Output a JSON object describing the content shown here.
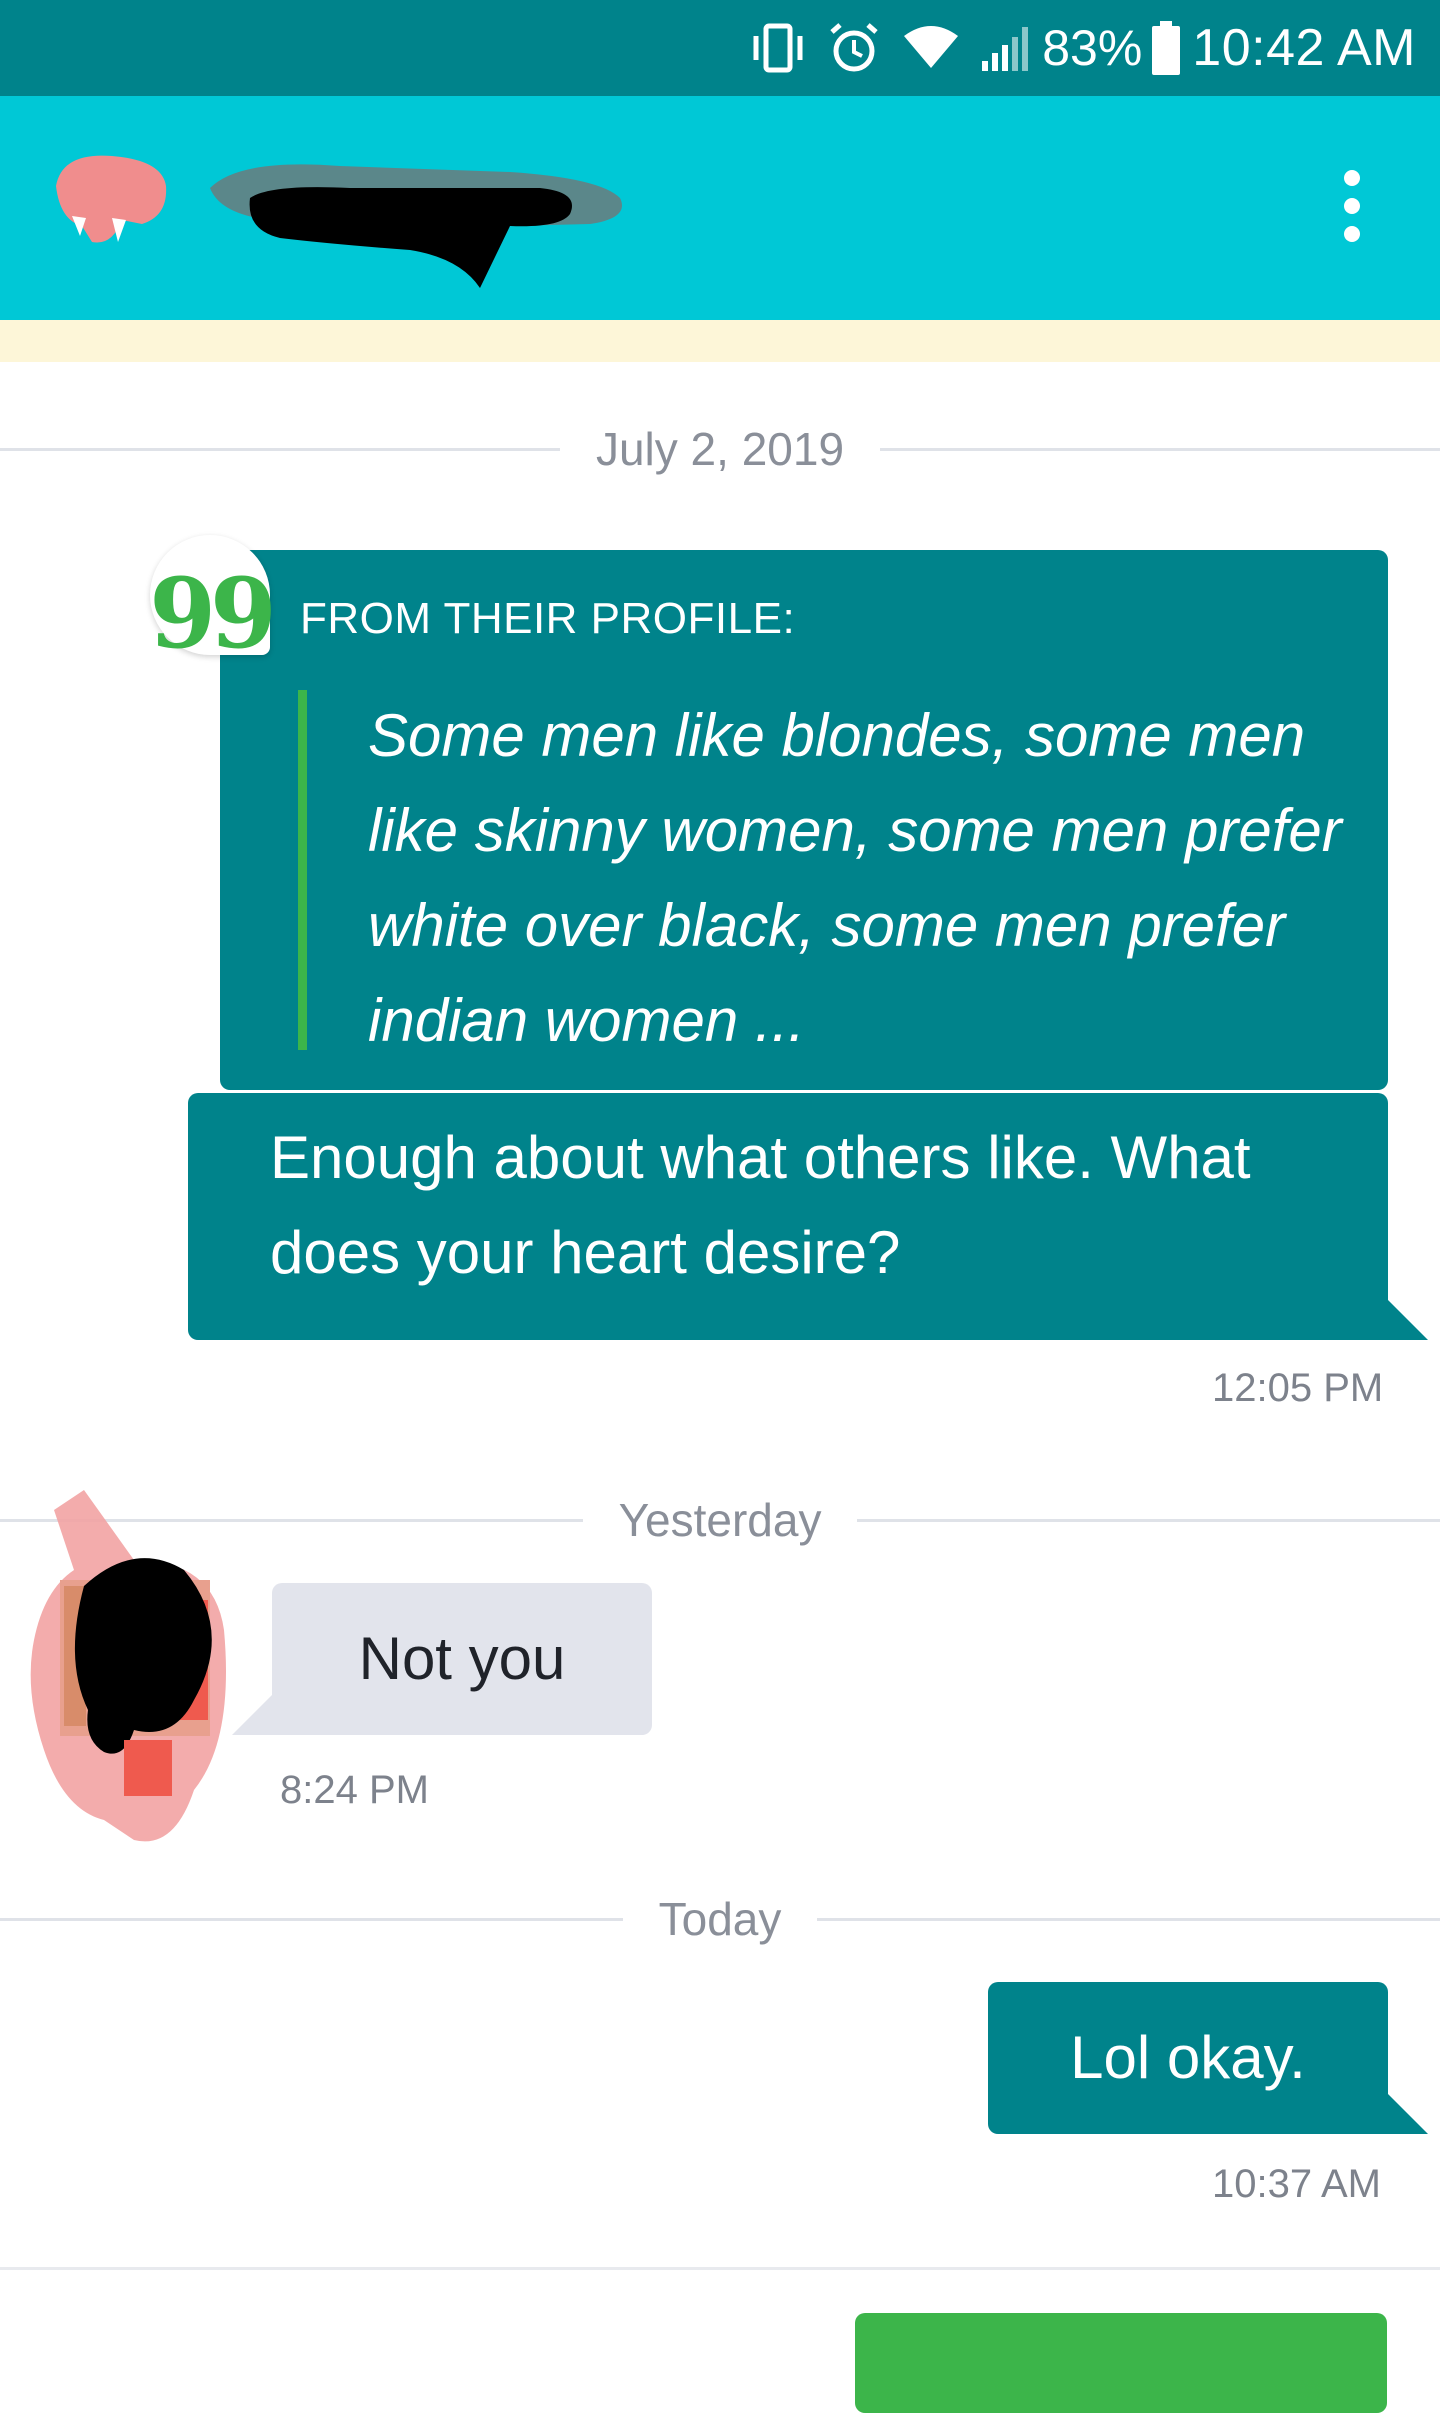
{
  "status_bar": {
    "battery_percent": "83%",
    "time": "10:42 AM",
    "icons": [
      "vibrate-icon",
      "alarm-icon",
      "wifi-icon",
      "signal-icon",
      "battery-icon"
    ]
  },
  "app_bar": {
    "contact_name_redacted": true,
    "overflow_icon": "more-vert-icon"
  },
  "conversation": {
    "separators": {
      "first": "July 2, 2019",
      "second": "Yesterday",
      "third": "Today"
    },
    "profile_quote": {
      "label": "FROM THEIR PROFILE:",
      "badge_glyph": "99",
      "text": "Some men like blondes, some men like skinny women, some men prefer white over black, some men prefer indian women ..."
    },
    "messages": [
      {
        "direction": "out",
        "text": "Enough about what others like. What does your heart desire?",
        "time": "12:05 PM"
      },
      {
        "direction": "in",
        "text": "Not you",
        "time": "8:24 PM"
      },
      {
        "direction": "out",
        "text": "Lol okay.",
        "time": "10:37 AM"
      }
    ]
  },
  "colors": {
    "status_bar": "#00838b",
    "app_bar": "#00c8d6",
    "outgoing_bubble": "#00838b",
    "incoming_bubble": "#e2e4ec",
    "accent_green": "#3cb54a",
    "banner": "#fdf6d8"
  }
}
